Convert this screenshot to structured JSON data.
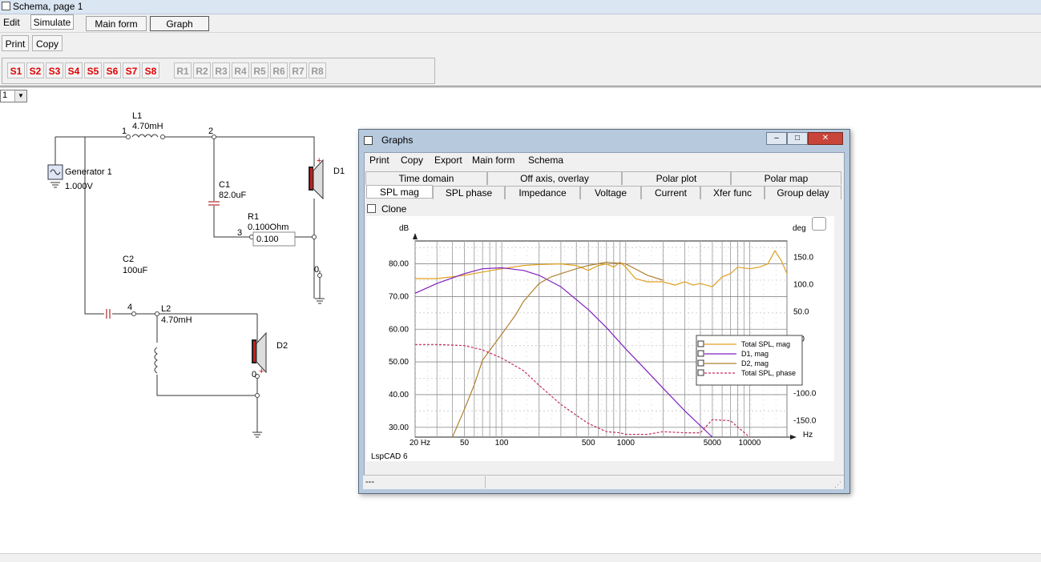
{
  "window": {
    "title": "Schema, page 1"
  },
  "menu": {
    "items": [
      "Edit",
      "Simulate"
    ],
    "main_form": "Main form",
    "graph": "Graph"
  },
  "toolbar": {
    "print": "Print",
    "copy": "Copy",
    "s_buttons": [
      "S1",
      "S2",
      "S3",
      "S4",
      "S5",
      "S6",
      "S7",
      "S8"
    ],
    "r_buttons": [
      "R1",
      "R2",
      "R3",
      "R4",
      "R5",
      "R6",
      "R7",
      "R8"
    ]
  },
  "page_selector": {
    "value": "1"
  },
  "schematic": {
    "generator": {
      "name": "Generator 1",
      "value": "1.000V"
    },
    "L1": {
      "name": "L1",
      "value": "4.70mH"
    },
    "C1": {
      "name": "C1",
      "value": "82.0uF"
    },
    "R1": {
      "name": "R1",
      "value": "0.100Ohm",
      "edit_value": "0.100"
    },
    "C2": {
      "name": "C2",
      "value": "100uF"
    },
    "L2": {
      "name": "L2",
      "value": "4.70mH"
    },
    "D1": "D1",
    "D2": "D2",
    "nodes": {
      "n0a": "0",
      "n0b": "0",
      "n1": "1",
      "n2": "2",
      "n3": "3",
      "n4": "4"
    },
    "plus_sign": "+"
  },
  "graphs": {
    "title": "Graphs",
    "menu": [
      "Print",
      "Copy",
      "Export",
      "Main form",
      "Schema"
    ],
    "tabs_row1": [
      "Time domain",
      "Off axis, overlay",
      "Polar plot",
      "Polar map"
    ],
    "tabs_row2": [
      "SPL mag",
      "SPL phase",
      "Impedance",
      "Voltage",
      "Current",
      "Xfer func",
      "Group delay"
    ],
    "clone": "Clone",
    "status": "---",
    "controls": {
      "minimize": "–",
      "maximize": "□",
      "close": "✕"
    }
  },
  "chart_data": {
    "type": "line",
    "ylabel": "dB",
    "y2label": "deg",
    "xunit": "Hz",
    "x_scale": "log",
    "xlim": [
      20,
      20000
    ],
    "ylim": [
      27,
      87
    ],
    "y2lim": [
      -180,
      180
    ],
    "x_ticks": [
      "20 Hz",
      "50",
      "100",
      "500",
      "1000",
      "5000",
      "10000"
    ],
    "y_ticks": [
      "80.00",
      "70.00",
      "60.00",
      "50.00",
      "40.00",
      "30.00"
    ],
    "y2_ticks": [
      "150.0",
      "100.0",
      "50.0",
      "0.0",
      "-100.0",
      "-150.0"
    ],
    "watermark": "LspCAD 6",
    "grid": true,
    "legend_position": "right",
    "series": [
      {
        "name": "Total SPL, mag",
        "color": "#e0a020",
        "axis": "left",
        "x": [
          20,
          30,
          50,
          70,
          100,
          150,
          200,
          300,
          400,
          500,
          600,
          700,
          800,
          900,
          1000,
          1200,
          1500,
          2000,
          2500,
          3000,
          3500,
          4000,
          5000,
          6000,
          7000,
          8000,
          10000,
          12000,
          14000,
          16000,
          18000,
          20000
        ],
        "y": [
          75.5,
          75.5,
          76.5,
          77.5,
          78.5,
          79.5,
          79.8,
          80.0,
          79.5,
          78.0,
          79.5,
          80.0,
          79.0,
          80.5,
          79.0,
          75.5,
          74.5,
          74.5,
          73.5,
          74.5,
          73.5,
          74.0,
          73.0,
          76.0,
          77.0,
          79.0,
          78.5,
          79.0,
          80.0,
          84.0,
          81.0,
          77.0
        ]
      },
      {
        "name": "D1, mag",
        "color": "#8020c0",
        "axis": "left",
        "x": [
          20,
          30,
          50,
          70,
          100,
          150,
          200,
          300,
          500,
          700,
          1000,
          1500,
          2000,
          3000,
          4000,
          5000
        ],
        "y": [
          71.0,
          74.0,
          77.0,
          78.5,
          78.8,
          78.0,
          76.5,
          73.0,
          66.0,
          60.5,
          54.0,
          47.0,
          42.0,
          35.0,
          30.5,
          27.0
        ]
      },
      {
        "name": "D2, mag",
        "color": "#b08030",
        "axis": "left",
        "x": [
          40,
          50,
          60,
          70,
          100,
          130,
          150,
          200,
          250,
          300,
          400,
          500,
          700,
          1000,
          1500,
          2000
        ],
        "y": [
          27.0,
          35.5,
          43.0,
          50.5,
          58.5,
          64.5,
          68.5,
          74.0,
          76.0,
          77.0,
          78.5,
          79.5,
          80.5,
          80.0,
          76.5,
          75.0
        ]
      },
      {
        "name": "Total SPL, phase",
        "color": "#c03060",
        "axis": "right",
        "dashed": true,
        "x": [
          20,
          30,
          50,
          70,
          100,
          150,
          200,
          300,
          400,
          500,
          700,
          900,
          1000,
          1500,
          2000,
          3000,
          4000,
          5000,
          7000,
          10000
        ],
        "y": [
          -10,
          -10,
          -12,
          -20,
          -35,
          -58,
          -85,
          -120,
          -140,
          -155,
          -170,
          -172,
          -175,
          -175,
          -170,
          -172,
          -172,
          -148,
          -150,
          -180
        ]
      }
    ]
  }
}
